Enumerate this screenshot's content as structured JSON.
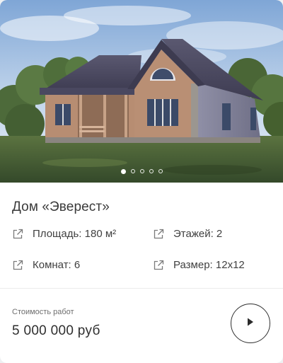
{
  "card": {
    "title": "Дом «Эверест»",
    "gallery": {
      "slide_count": 5,
      "active_slide": 1
    },
    "specs": [
      {
        "icon": "external-link-icon",
        "text": "Площадь: 180 м²"
      },
      {
        "icon": "external-link-icon",
        "text": "Этажей: 2"
      },
      {
        "icon": "external-link-icon",
        "text": "Комнат: 6"
      },
      {
        "icon": "external-link-icon",
        "text": "Размер: 12x12"
      }
    ],
    "price_label": "Стоимость работ",
    "price": "5 000 000 руб",
    "action_icon": "play-arrow-icon"
  },
  "colors": {
    "text_primary": "#2b2b2b",
    "text_secondary": "#6e6e6e",
    "roof": "#4a4860",
    "wall": "#b98f74",
    "grass": "#3f5a2c"
  }
}
